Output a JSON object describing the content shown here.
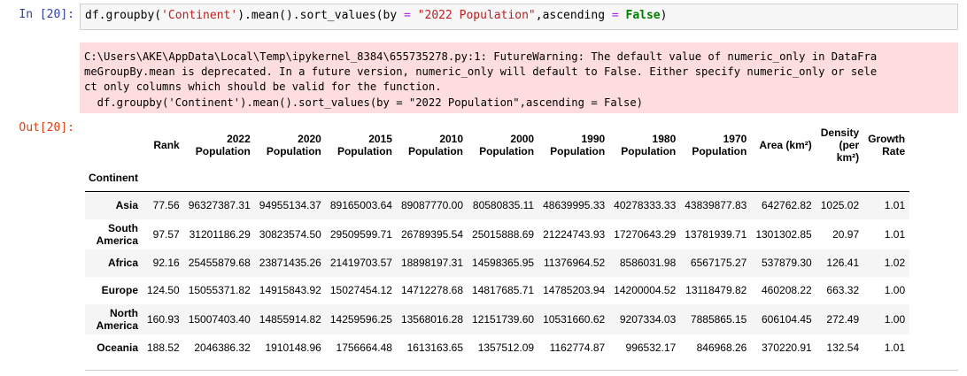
{
  "input": {
    "prompt": "In [20]:",
    "code": {
      "p1": "df.groupby(",
      "s1": "'Continent'",
      "p2": ").mean().sort_values(by ",
      "op1": "=",
      "p3": " ",
      "s2": "\"2022 Population\"",
      "p4": ",ascending ",
      "op2": "=",
      "p5": " ",
      "kw": "False",
      "p6": ")"
    }
  },
  "stderr": {
    "lines": [
      "C:\\Users\\AKE\\AppData\\Local\\Temp\\ipykernel_8384\\655735278.py:1: FutureWarning: The default value of numeric_only in DataFra",
      "meGroupBy.mean is deprecated. In a future version, numeric_only will default to False. Either specify numeric_only or sele",
      "ct only columns which should be valid for the function.",
      "  df.groupby('Continent').mean().sort_values(by = \"2022 Population\",ascending = False)"
    ]
  },
  "output": {
    "prompt": "Out[20]:",
    "table": {
      "columns": [
        [
          "Rank"
        ],
        [
          "2022",
          "Population"
        ],
        [
          "2020",
          "Population"
        ],
        [
          "2015",
          "Population"
        ],
        [
          "2010",
          "Population"
        ],
        [
          "2000",
          "Population"
        ],
        [
          "1990",
          "Population"
        ],
        [
          "1980",
          "Population"
        ],
        [
          "1970",
          "Population"
        ],
        [
          "Area (km²)"
        ],
        [
          "Density",
          "(per",
          "km²)"
        ],
        [
          "Growth",
          "Rate"
        ]
      ],
      "index_name": "Continent",
      "rows": [
        {
          "index": [
            "Asia"
          ],
          "values": [
            "77.56",
            "96327387.31",
            "94955134.37",
            "89165003.64",
            "89087770.00",
            "80580835.11",
            "48639995.33",
            "40278333.33",
            "43839877.83",
            "642762.82",
            "1025.02",
            "1.01"
          ]
        },
        {
          "index": [
            "South",
            "America"
          ],
          "values": [
            "97.57",
            "31201186.29",
            "30823574.50",
            "29509599.71",
            "26789395.54",
            "25015888.69",
            "21224743.93",
            "17270643.29",
            "13781939.71",
            "1301302.85",
            "20.97",
            "1.01"
          ]
        },
        {
          "index": [
            "Africa"
          ],
          "values": [
            "92.16",
            "25455879.68",
            "23871435.26",
            "21419703.57",
            "18898197.31",
            "14598365.95",
            "11376964.52",
            "8586031.98",
            "6567175.27",
            "537879.30",
            "126.41",
            "1.02"
          ]
        },
        {
          "index": [
            "Europe"
          ],
          "values": [
            "124.50",
            "15055371.82",
            "14915843.92",
            "15027454.12",
            "14712278.68",
            "14817685.71",
            "14785203.94",
            "14200004.52",
            "13118479.82",
            "460208.22",
            "663.32",
            "1.00"
          ]
        },
        {
          "index": [
            "North",
            "America"
          ],
          "values": [
            "160.93",
            "15007403.40",
            "14855914.82",
            "14259596.25",
            "13568016.28",
            "12151739.60",
            "10531660.62",
            "9207334.03",
            "7885865.15",
            "606104.45",
            "272.49",
            "1.00"
          ]
        },
        {
          "index": [
            "Oceania"
          ],
          "values": [
            "188.52",
            "2046386.32",
            "1910148.96",
            "1756664.48",
            "1613163.65",
            "1357512.09",
            "1162774.87",
            "996532.17",
            "846968.26",
            "370220.91",
            "132.54",
            "1.01"
          ]
        }
      ]
    }
  }
}
